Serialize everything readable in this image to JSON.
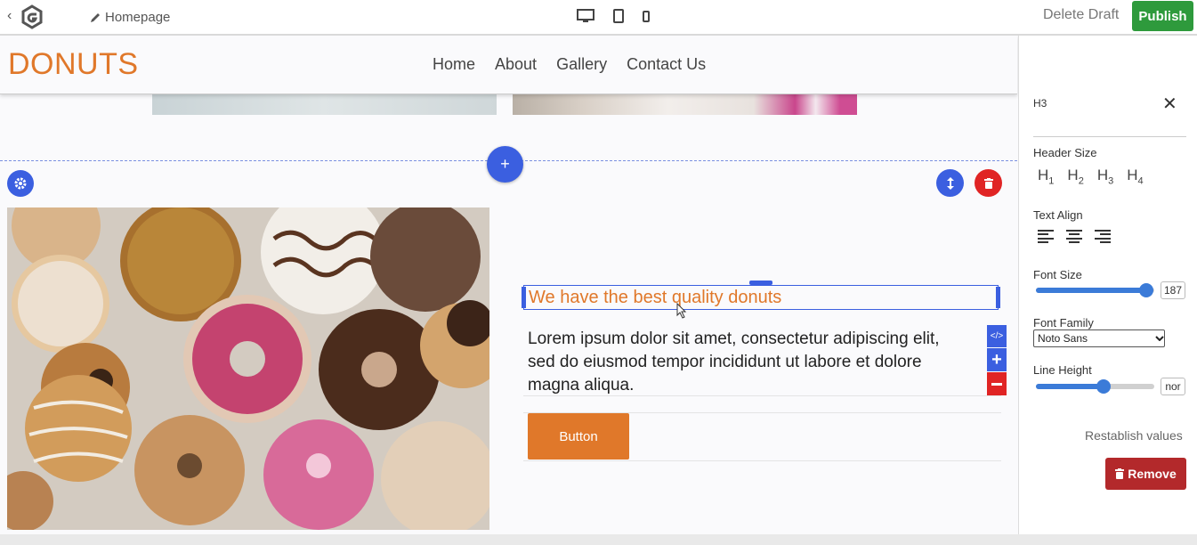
{
  "editor": {
    "page_name": "Homepage",
    "delete_draft": "Delete Draft",
    "publish": "Publish"
  },
  "site": {
    "brand": "DONUTS",
    "nav": [
      "Home",
      "About",
      "Gallery",
      "Contact Us"
    ],
    "heading": "We have the best quality donuts",
    "paragraph": "Lorem ipsum dolor sit amet, consectetur adipiscing elit, sed do eiusmod tempor incididunt ut labore et dolore magna aliqua.",
    "button": "Button",
    "code_tool": "</>",
    "add_tool": "+"
  },
  "panel": {
    "title": "H3",
    "header_size_label": "Header Size",
    "header_sizes": [
      {
        "letter": "H",
        "num": "1"
      },
      {
        "letter": "H",
        "num": "2"
      },
      {
        "letter": "H",
        "num": "3"
      },
      {
        "letter": "H",
        "num": "4"
      }
    ],
    "text_align_label": "Text Align",
    "font_size_label": "Font Size",
    "font_size_value": "187",
    "font_size_fraction": 0.93,
    "font_family_label": "Font Family",
    "font_family_value": "Noto Sans",
    "line_height_label": "Line Height",
    "line_height_value": "nor",
    "line_height_fraction": 0.57,
    "restablish": "Restablish values",
    "remove": "Remove"
  },
  "colors": {
    "accent": "#e0782a",
    "primary": "#3b5fe0",
    "danger": "#e02424",
    "publish": "#2e9a3c",
    "remove": "#b3292b"
  }
}
